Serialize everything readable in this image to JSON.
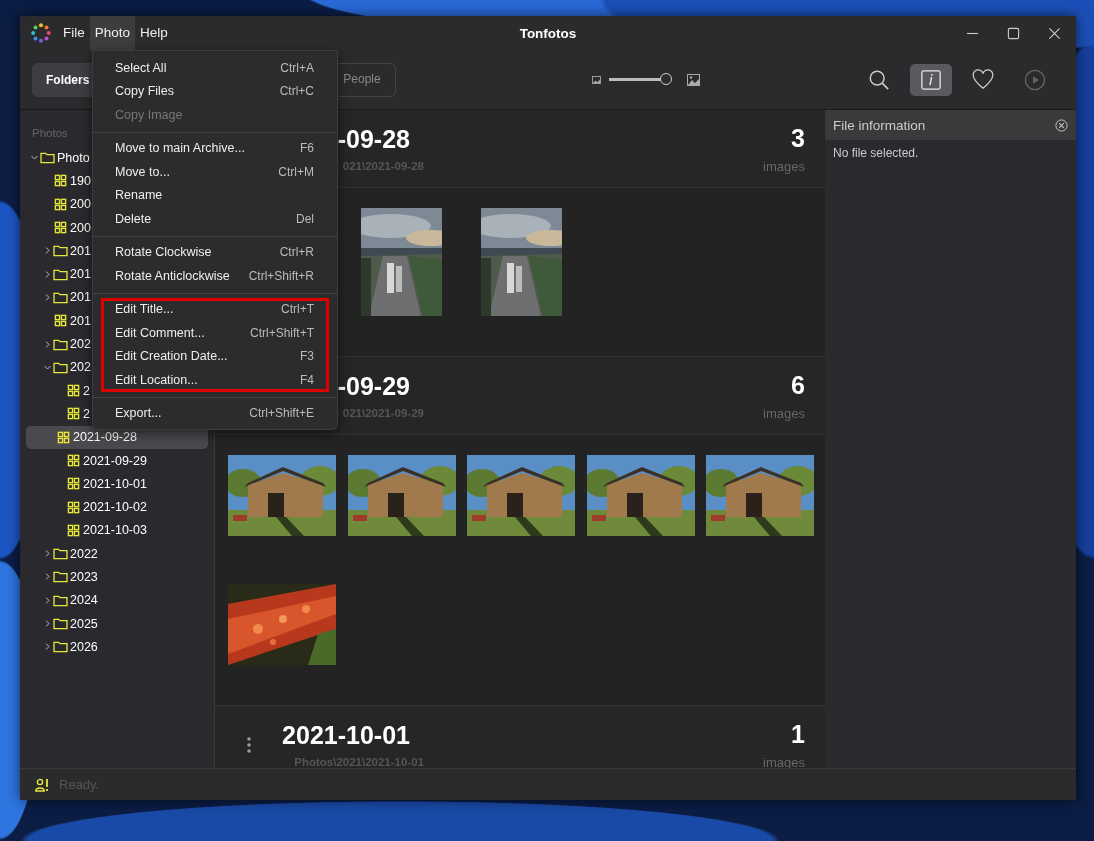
{
  "window": {
    "title": "Tonfotos"
  },
  "menubar": [
    {
      "label": "File",
      "selected": false
    },
    {
      "label": "Photo",
      "selected": true
    },
    {
      "label": "Help",
      "selected": false
    }
  ],
  "tabs": [
    {
      "label": "Folders",
      "selected": true
    },
    {
      "label": "People",
      "selected": false
    }
  ],
  "zoom_slider": {
    "level": 1
  },
  "toolbar_buttons": [
    {
      "kind": "search",
      "selected": false,
      "disabled": false
    },
    {
      "kind": "info",
      "selected": true,
      "disabled": false
    },
    {
      "kind": "favorite",
      "selected": false,
      "disabled": false
    },
    {
      "kind": "slideshow",
      "selected": false,
      "disabled": true
    }
  ],
  "sidebar": {
    "heading": "Photos",
    "tree": [
      {
        "label": "Photo",
        "kind": "folder",
        "expanded": true,
        "selected": false,
        "children": [
          {
            "label": "190",
            "kind": "album",
            "selected": false
          },
          {
            "label": "200",
            "kind": "album",
            "selected": false
          },
          {
            "label": "200",
            "kind": "album",
            "selected": false
          },
          {
            "label": "201",
            "kind": "folder",
            "expanded": false,
            "selected": false
          },
          {
            "label": "201",
            "kind": "folder",
            "expanded": false,
            "selected": false
          },
          {
            "label": "201",
            "kind": "folder",
            "expanded": false,
            "selected": false
          },
          {
            "label": "201",
            "kind": "album",
            "selected": false
          },
          {
            "label": "202",
            "kind": "folder",
            "expanded": false,
            "selected": false
          },
          {
            "label": "202",
            "kind": "folder",
            "expanded": true,
            "selected": false,
            "children": [
              {
                "label": "2",
                "kind": "album",
                "selected": false
              },
              {
                "label": "2",
                "kind": "album",
                "selected": false
              },
              {
                "label": "2021-09-28",
                "kind": "album",
                "selected": true
              },
              {
                "label": "2021-09-29",
                "kind": "album",
                "selected": false
              },
              {
                "label": "2021-10-01",
                "kind": "album",
                "selected": false
              },
              {
                "label": "2021-10-02",
                "kind": "album",
                "selected": false
              },
              {
                "label": "2021-10-03",
                "kind": "album",
                "selected": false
              }
            ]
          },
          {
            "label": "2022",
            "kind": "folder",
            "expanded": false,
            "selected": false
          },
          {
            "label": "2023",
            "kind": "folder",
            "expanded": false,
            "selected": false
          },
          {
            "label": "2024",
            "kind": "folder",
            "expanded": false,
            "selected": false
          },
          {
            "label": "2025",
            "kind": "folder",
            "expanded": false,
            "selected": false
          },
          {
            "label": "2026",
            "kind": "folder",
            "expanded": false,
            "selected": false
          }
        ]
      }
    ]
  },
  "groups": [
    {
      "title": "-09-28",
      "path": "021\\2021-09-28",
      "count": "3",
      "count_label": "images"
    },
    {
      "title": "-09-29",
      "path": "021\\2021-09-29",
      "count": "6",
      "count_label": "images"
    },
    {
      "title": "2021-10-01",
      "path": "Photos\\2021\\2021-10-01",
      "count": "1",
      "count_label": "images"
    }
  ],
  "info_panel": {
    "title": "File information",
    "message": "No file selected."
  },
  "status_bar": {
    "text": "Ready."
  },
  "menu": {
    "sections": [
      {
        "highlighted": false,
        "items": [
          {
            "label": "Select All",
            "shortcut": "Ctrl+A",
            "disabled": false
          },
          {
            "label": "Copy Files",
            "shortcut": "Ctrl+C",
            "disabled": false
          },
          {
            "label": "Copy Image",
            "disabled": true
          }
        ]
      },
      {
        "highlighted": false,
        "items": [
          {
            "label": "Move to main Archive...",
            "shortcut": "F6",
            "disabled": false
          },
          {
            "label": "Move to...",
            "shortcut": "Ctrl+M",
            "disabled": false
          },
          {
            "label": "Rename",
            "disabled": false
          },
          {
            "label": "Delete",
            "shortcut": "Del",
            "disabled": false
          }
        ]
      },
      {
        "highlighted": false,
        "items": [
          {
            "label": "Rotate Clockwise",
            "shortcut": "Ctrl+R",
            "disabled": false
          },
          {
            "label": "Rotate Anticlockwise",
            "shortcut": "Ctrl+Shift+R",
            "disabled": false
          }
        ]
      },
      {
        "highlighted": true,
        "items": [
          {
            "label": "Edit Title...",
            "shortcut": "Ctrl+T",
            "disabled": false
          },
          {
            "label": "Edit Comment...",
            "shortcut": "Ctrl+Shift+T",
            "disabled": false
          },
          {
            "label": "Edit Creation Date...",
            "shortcut": "F3",
            "disabled": false
          },
          {
            "label": "Edit Location...",
            "shortcut": "F4",
            "disabled": false
          }
        ]
      },
      {
        "highlighted": false,
        "items": [
          {
            "label": "Export...",
            "shortcut": "Ctrl+Shift+E",
            "disabled": false
          }
        ]
      }
    ]
  }
}
